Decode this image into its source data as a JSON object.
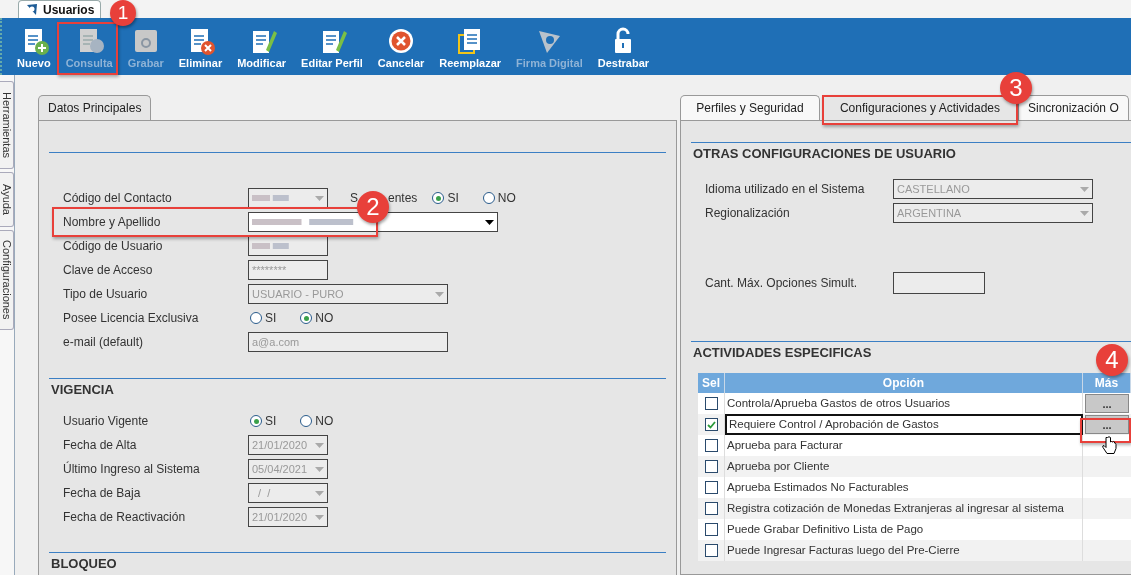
{
  "window_tab": {
    "title": "Usuarios"
  },
  "toolbar": [
    {
      "label": "Nuevo",
      "kind": "new",
      "disabled": false
    },
    {
      "label": "Consulta",
      "kind": "query",
      "disabled": true
    },
    {
      "label": "Grabar",
      "kind": "save",
      "disabled": true
    },
    {
      "label": "Eliminar",
      "kind": "delete",
      "disabled": false
    },
    {
      "label": "Modificar",
      "kind": "edit",
      "disabled": false
    },
    {
      "label": "Editar Perfil",
      "kind": "edit",
      "disabled": false
    },
    {
      "label": "Cancelar",
      "kind": "cancel",
      "disabled": false
    },
    {
      "label": "Reemplazar",
      "kind": "replace",
      "disabled": false
    },
    {
      "label": "Firma Digital",
      "kind": "sign",
      "disabled": true
    },
    {
      "label": "Destrabar",
      "kind": "unlock",
      "disabled": false
    }
  ],
  "side_tabs": [
    "Herramientas",
    "Ayuda",
    "Configuraciones"
  ],
  "left_panel": {
    "tabs": [
      {
        "label": "Datos Principales",
        "selected": true
      }
    ],
    "sections": [
      {
        "rows": [
          {
            "label": "Código del Contacto",
            "kind": "blurred_combo",
            "extra": {
              "label_start": "S",
              "label_end": "entes",
              "options": [
                {
                  "label": "SI",
                  "selected": true
                },
                {
                  "label": "NO",
                  "selected": false
                }
              ]
            }
          },
          {
            "label": "Nombre y Apellido",
            "kind": "blurred_wide_combo"
          },
          {
            "label": "Código de Usuario",
            "kind": "blurred_text"
          },
          {
            "label": "Clave de Acceso",
            "kind": "text",
            "value": "********"
          },
          {
            "label": "Tipo de Usuario",
            "kind": "combo_wide",
            "value": "USUARIO - PURO"
          },
          {
            "label": "Posee Licencia Exclusiva",
            "kind": "radio",
            "options": [
              {
                "label": "SI",
                "selected": false
              },
              {
                "label": "NO",
                "selected": true
              }
            ]
          },
          {
            "label": "e-mail (default)",
            "kind": "text_wide",
            "value": "a@a.com"
          }
        ]
      },
      {
        "title": "VIGENCIA",
        "rows": [
          {
            "label": "Usuario Vigente",
            "kind": "radio",
            "options": [
              {
                "label": "SI",
                "selected": true
              },
              {
                "label": "NO",
                "selected": false
              }
            ]
          },
          {
            "label": "Fecha de Alta",
            "kind": "combo",
            "value": "21/01/2020"
          },
          {
            "label": "Último Ingreso al Sistema",
            "kind": "combo",
            "value": "05/04/2021"
          },
          {
            "label": "Fecha de Baja",
            "kind": "combo",
            "value": "  /  /"
          },
          {
            "label": "Fecha de Reactivación",
            "kind": "combo",
            "value": "21/01/2020"
          }
        ]
      },
      {
        "title": "BLOQUEO"
      }
    ]
  },
  "right_panel": {
    "tabs": [
      {
        "label": "Perfiles y Seguridad",
        "selected": false
      },
      {
        "label": "Configuraciones y Actividades",
        "selected": true
      },
      {
        "label": "Sincronización O",
        "selected": false
      }
    ],
    "section": {
      "title": "OTRAS CONFIGURACIONES DE USUARIO",
      "rows": [
        {
          "label": "Idioma utilizado en el Sistema",
          "kind": "combo_wide",
          "value": "CASTELLANO"
        },
        {
          "label": "Regionalización",
          "kind": "combo_wide",
          "value": "ARGENTINA"
        },
        {
          "label": "Cant. Máx. Opciones Simult.",
          "kind": "empty_box"
        }
      ]
    },
    "activities": {
      "title": "ACTIVIDADES ESPECIFICAS",
      "columns": [
        "Sel",
        "Opción",
        "Más"
      ],
      "rows": [
        {
          "option": "Controla/Aprueba Gastos de otros Usuarios",
          "checked": false,
          "selected": false,
          "more": "..."
        },
        {
          "option": "Requiere Control / Aprobación de Gastos",
          "checked": true,
          "selected": true,
          "more": "..."
        },
        {
          "option": "Aprueba para Facturar",
          "checked": false,
          "selected": false
        },
        {
          "option": "Aprueba por Cliente",
          "checked": false,
          "selected": false
        },
        {
          "option": "Aprueba Estimados No Facturables",
          "checked": false,
          "selected": false
        },
        {
          "option": "Registra cotización de Monedas Extranjeras al ingresar al sistema",
          "checked": false,
          "selected": false
        },
        {
          "option": "Puede Grabar Definitivo Lista de Pago",
          "checked": false,
          "selected": false
        },
        {
          "option": "Puede Ingresar Facturas luego del Pre-Cierre",
          "checked": false,
          "selected": false
        }
      ]
    }
  },
  "annotations": [
    {
      "label": "1"
    },
    {
      "label": "2"
    },
    {
      "label": "3"
    },
    {
      "label": "4"
    }
  ]
}
